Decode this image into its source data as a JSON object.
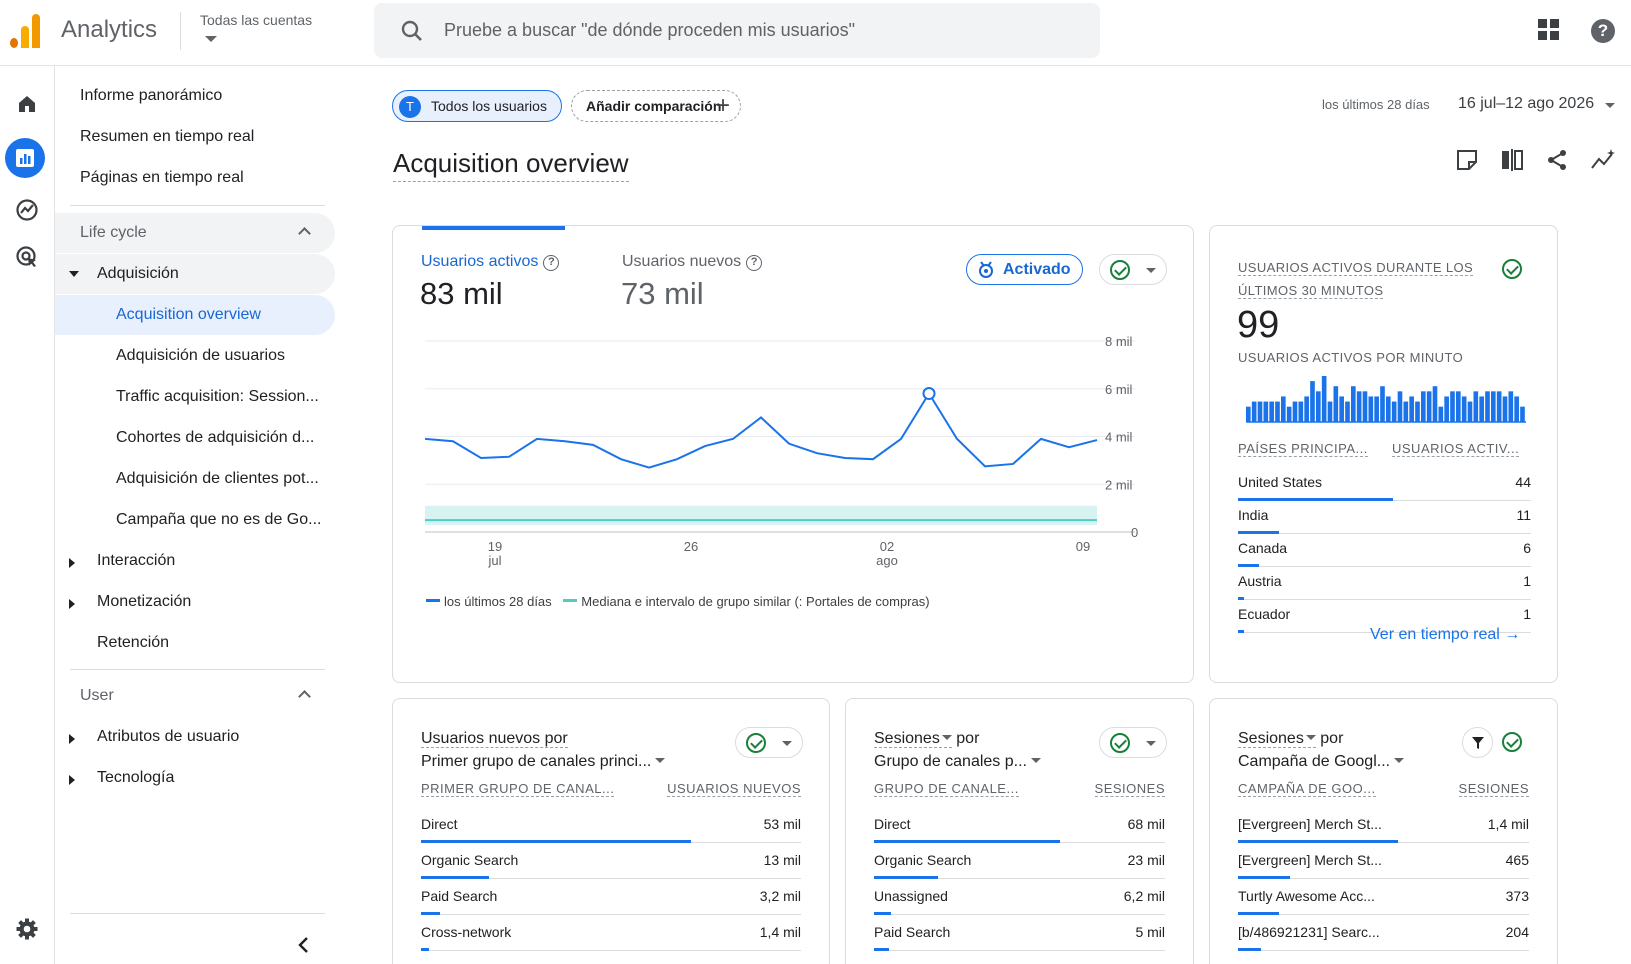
{
  "app": {
    "brand": "Analytics",
    "account": "Todas las cuentas"
  },
  "search": {
    "placeholder": "Pruebe a buscar \"de dónde proceden mis usuarios\""
  },
  "icons": {
    "apps": "apps-grid-icon",
    "help": "help-icon",
    "home": "home-icon",
    "reports": "reports-icon",
    "explore": "explore-icon",
    "advertising": "advertising-icon",
    "settings": "settings-gear-icon"
  },
  "colors": {
    "accent": "#1a73e8",
    "success": "#188038",
    "benchmark": "#4ecdc4"
  },
  "nav": {
    "top": [
      "Informe panorámico",
      "Resumen en tiempo real",
      "Páginas en tiempo real"
    ],
    "lifecycle": "Life cycle",
    "acquisition": "Adquisición",
    "acq_items": [
      "Acquisition overview",
      "Adquisición de usuarios",
      "Traffic acquisition: Session...",
      "Cohortes de adquisición d...",
      "Adquisición de clientes pot...",
      "Campaña que no es de Go..."
    ],
    "engagement": "Interacción",
    "monetization": "Monetización",
    "retention": "Retención",
    "user": "User",
    "user_attrs": "Atributos de usuario",
    "tech": "Tecnología"
  },
  "toolbar": {
    "users_chip": "Todos los usuarios",
    "users_avatar": "T",
    "add_compare": "Añadir comparación",
    "date_label": "los últimos 28 días",
    "date_range": "16 jul–12 ago 2026"
  },
  "page": {
    "title": "Acquisition overview"
  },
  "main_card": {
    "metric1_label": "Usuarios activos",
    "metric1_value": "83 mil",
    "metric2_label": "Usuarios nuevos",
    "metric2_value": "73 mil",
    "badge": "Activado",
    "legend1": "los últimos 28 días",
    "legend2": "Mediana e intervalo de grupo similar (: Portales de compras)"
  },
  "chart_data": {
    "type": "line",
    "y_ticks": [
      "8 mil",
      "6 mil",
      "4 mil",
      "2 mil",
      "0"
    ],
    "ylim": [
      0,
      8000
    ],
    "x_ticks": [
      {
        "day": "19",
        "month": "jul"
      },
      {
        "day": "26",
        "month": ""
      },
      {
        "day": "02",
        "month": "ago"
      },
      {
        "day": "09",
        "month": ""
      }
    ],
    "series": [
      {
        "name": "los últimos 28 días",
        "values": [
          3900,
          3800,
          3100,
          3150,
          3900,
          3800,
          3650,
          3050,
          2700,
          3050,
          3600,
          3900,
          4800,
          3700,
          3300,
          3100,
          3050,
          3900,
          5800,
          3900,
          2750,
          2850,
          3900,
          3550,
          3850
        ]
      },
      {
        "name": "Mediana e intervalo de grupo similar (: Portales de compras)",
        "values": [
          500,
          500,
          500,
          500,
          500,
          500,
          500,
          500,
          500,
          500,
          500,
          500,
          500,
          500,
          500,
          500,
          500,
          500,
          500,
          500,
          500,
          500,
          500,
          500,
          500
        ],
        "band": [
          300,
          1100
        ]
      }
    ]
  },
  "realtime": {
    "title": "USUARIOS ACTIVOS DURANTE LOS ÚLTIMOS 30 MINUTOS",
    "value": "99",
    "per_minute": "USUARIOS ACTIVOS POR MINUTO",
    "minute_bars": [
      3,
      4,
      4,
      4,
      4,
      4,
      5,
      3,
      4,
      4,
      5,
      8,
      6,
      9,
      4,
      7,
      5,
      4,
      7,
      6,
      6,
      5,
      5,
      7,
      5,
      4,
      6,
      4,
      5,
      4,
      6,
      6,
      7,
      3,
      5,
      6,
      6,
      5,
      4,
      6,
      5,
      6,
      6,
      6,
      5,
      6,
      5,
      3
    ],
    "col1": "PAÍSES PRINCIPA...",
    "col2": "USUARIOS ACTIV...",
    "rows": [
      {
        "k": "United States",
        "v": "44",
        "p": 0.53
      },
      {
        "k": "India",
        "v": "11",
        "p": 0.14
      },
      {
        "k": "Canada",
        "v": "6",
        "p": 0.07
      },
      {
        "k": "Austria",
        "v": "1",
        "p": 0.02
      },
      {
        "k": "Ecuador",
        "v": "1",
        "p": 0.02
      }
    ],
    "link": "Ver en tiempo real"
  },
  "card1": {
    "t1": "Usuarios nuevos por",
    "t2": "Primer grupo de canales princi...",
    "col1": "PRIMER GRUPO DE CANAL...",
    "col2": "USUARIOS NUEVOS",
    "rows": [
      {
        "k": "Direct",
        "v": "53 mil",
        "p": 0.71
      },
      {
        "k": "Organic Search",
        "v": "13 mil",
        "p": 0.18
      },
      {
        "k": "Paid Search",
        "v": "3,2 mil",
        "p": 0.05
      },
      {
        "k": "Cross-network",
        "v": "1,4 mil",
        "p": 0.02
      }
    ]
  },
  "card2": {
    "t1a": "Sesiones",
    "t1b": "por",
    "t2": "Grupo de canales p...",
    "col1": "GRUPO DE CANALE...",
    "col2": "SESIONES",
    "rows": [
      {
        "k": "Direct",
        "v": "68 mil",
        "p": 0.64
      },
      {
        "k": "Organic Search",
        "v": "23 mil",
        "p": 0.22
      },
      {
        "k": "Unassigned",
        "v": "6,2 mil",
        "p": 0.06
      },
      {
        "k": "Paid Search",
        "v": "5 mil",
        "p": 0.05
      }
    ]
  },
  "card3": {
    "t1a": "Sesiones",
    "t1b": "por",
    "t2": "Campaña de Googl...",
    "col1": "CAMPAÑA DE GOO...",
    "col2": "SESIONES",
    "rows": [
      {
        "k": "[Evergreen] Merch St...",
        "v": "1,4 mil",
        "p": 0.55
      },
      {
        "k": "[Evergreen] Merch St...",
        "v": "465",
        "p": 0.18
      },
      {
        "k": "Turtly Awesome Acc...",
        "v": "373",
        "p": 0.14
      },
      {
        "k": "[b/486921231] Searc...",
        "v": "204",
        "p": 0.08
      }
    ]
  }
}
